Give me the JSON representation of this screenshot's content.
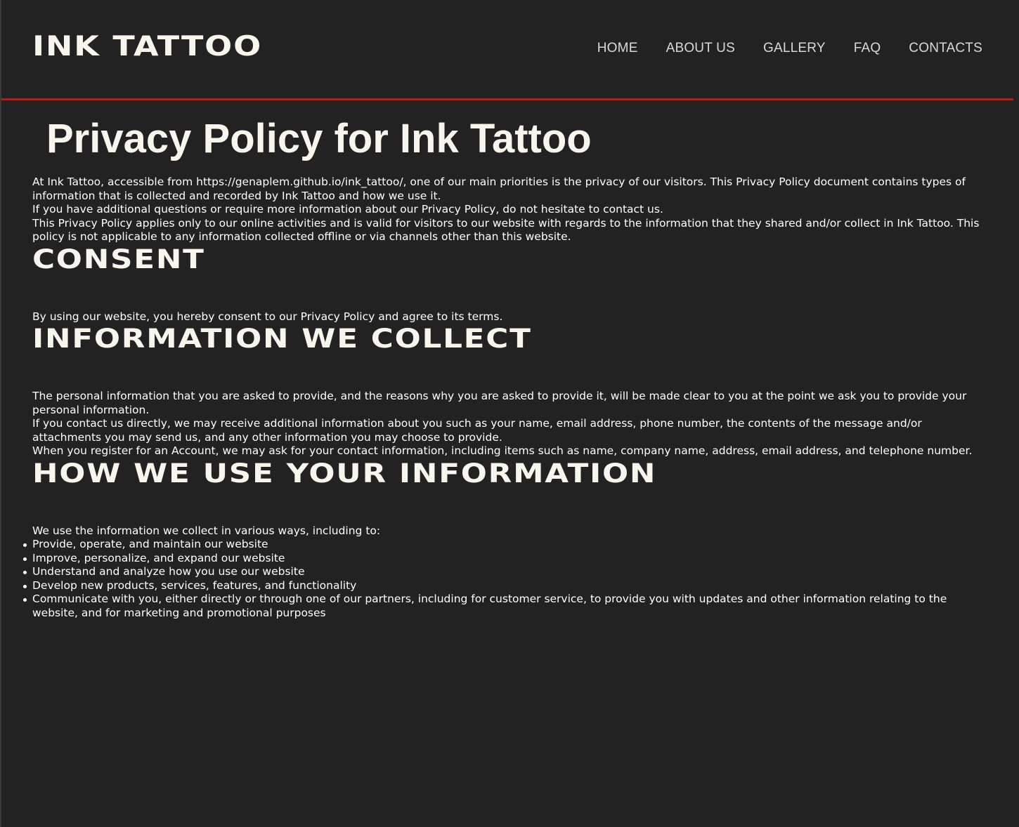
{
  "header": {
    "logo": "INK TATTOO",
    "nav": [
      "HOME",
      "ABOUT US",
      "GALLERY",
      "FAQ",
      "CONTACTS"
    ]
  },
  "colors": {
    "background": "#222222",
    "heading_text": "#f7f5ec",
    "nav_text": "#d9d9d9",
    "accent_rule": "#a3261e"
  },
  "page": {
    "title": "Privacy Policy for Ink Tattoo",
    "intro": [
      "At Ink Tattoo, accessible from https://genaplem.github.io/ink_tattoo/, one of our main priorities is the privacy of our visitors. This Privacy Policy document contains types of information that is collected and recorded by Ink Tattoo and how we use it.",
      "If you have additional questions or require more information about our Privacy Policy, do not hesitate to contact us.",
      "This Privacy Policy applies only to our online activities and is valid for visitors to our website with regards to the information that they shared and/or collect in Ink Tattoo. This policy is not applicable to any information collected offline or via channels other than this website."
    ]
  },
  "sections": {
    "consent": {
      "heading": "CONSENT",
      "paragraphs": [
        "By using our website, you hereby consent to our Privacy Policy and agree to its terms."
      ]
    },
    "info_collect": {
      "heading": "INFORMATION WE COLLECT",
      "paragraphs": [
        "The personal information that you are asked to provide, and the reasons why you are asked to provide it, will be made clear to you at the point we ask you to provide your personal information.",
        "If you contact us directly, we may receive additional information about you such as your name, email address, phone number, the contents of the message and/or attachments you may send us, and any other information you may choose to provide.",
        "When you register for an Account, we may ask for your contact information, including items such as name, company name, address, email address, and telephone number."
      ]
    },
    "use_info": {
      "heading": "HOW WE USE YOUR INFORMATION",
      "lead": "We use the information we collect in various ways, including to:",
      "items": [
        "Provide, operate, and maintain our website",
        "Improve, personalize, and expand our website",
        "Understand and analyze how you use our website",
        "Develop new products, services, features, and functionality",
        "Communicate with you, either directly or through one of our partners, including for customer service, to provide you with updates and other information relating to the website, and for marketing and promotional purposes"
      ]
    }
  }
}
